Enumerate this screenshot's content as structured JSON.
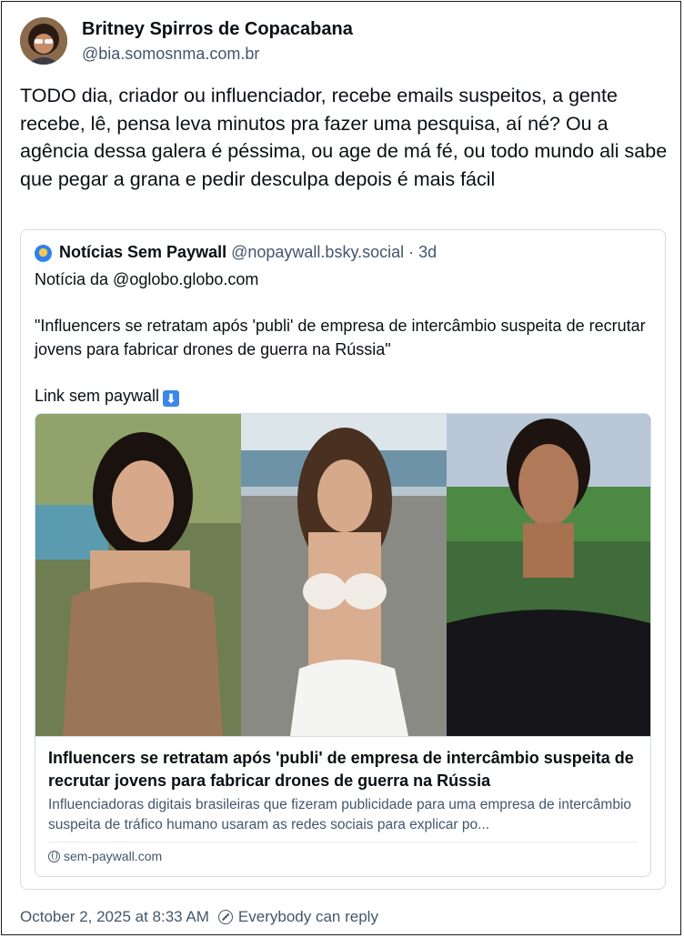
{
  "post": {
    "author_name": "Britney Spirros de Copacabana",
    "author_handle": "@bia.somosnma.com.br",
    "text": "TODO dia, criador ou influenciador, recebe emails suspeitos, a gente recebe, lê, pensa leva minutos pra fazer uma pesquisa, aí né? Ou a agência dessa galera é péssima, ou age de má fé, ou todo mundo ali sabe que pegar a grana e pedir desculpa depois é mais fácil",
    "timestamp": "October 2, 2025 at 8:33 AM",
    "reply_setting": "Everybody can reply"
  },
  "quote": {
    "author_name": "Notícias Sem Paywall",
    "author_handle": "@nopaywall.bsky.social",
    "separator": "·",
    "age": "3d",
    "text": "Notícia da @oglobo.globo.com\n\n\"Influencers se retratam após 'publi' de empresa de intercâmbio suspeita de recrutar jovens para fabricar drones de guerra na Rússia\"\n\nLink sem paywall",
    "link_emoji": "⬇"
  },
  "card": {
    "title": "Influencers se retratam após 'publi' de empresa de intercâmbio suspeita de recrutar jovens para fabricar drones de guerra na Rússia",
    "description": "Influenciadoras digitais brasileiras que fizeram publicidade para uma empresa de intercâmbio suspeita de tráfico humano usaram as redes sociais para explicar po...",
    "domain": "sem-paywall.com"
  },
  "icons": {
    "quote_avatar": "newspaper-globe-avatar",
    "domain": "globe-icon",
    "reply": "reply-restriction-icon",
    "link": "down-arrow-emoji"
  },
  "colors": {
    "text": "#0b0f14",
    "muted": "#42576c",
    "border": "#d4dbe2",
    "emoji_blue": "#3b88e8"
  }
}
